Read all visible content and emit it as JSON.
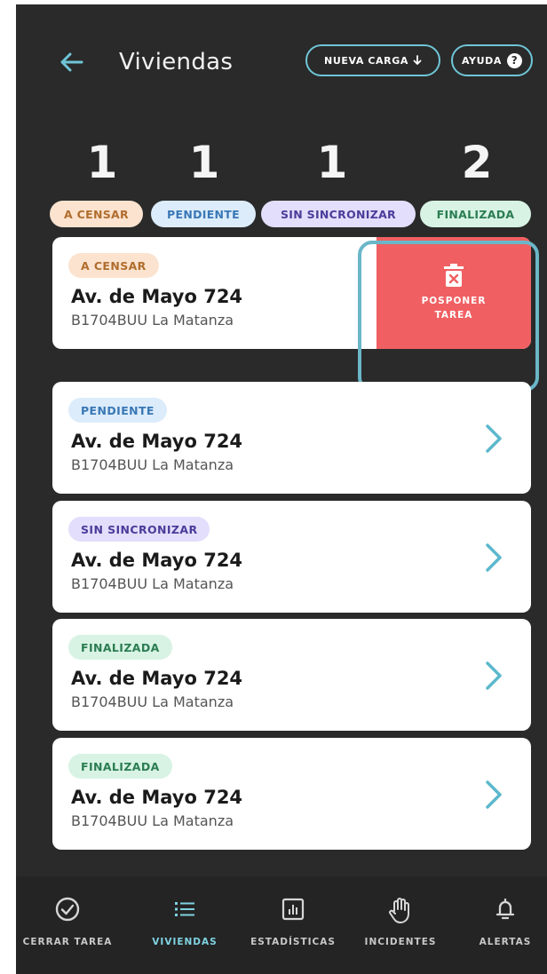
{
  "header": {
    "title": "Viviendas",
    "nueva_carga_label": "NUEVA CARGA",
    "nueva_carga_icon": "download-arrow-icon",
    "ayuda_label": "AYUDA",
    "ayuda_icon": "?"
  },
  "stats": [
    {
      "count": "1",
      "label": "A CENSAR"
    },
    {
      "count": "1",
      "label": "PENDIENTE"
    },
    {
      "count": "1",
      "label": "SIN SINCRONIZAR"
    },
    {
      "count": "2",
      "label": "FINALIZADA"
    }
  ],
  "cards": [
    {
      "status": "A CENSAR",
      "address": "Av. de Mayo 724",
      "locality": "B1704BUU La Matanza"
    },
    {
      "status": "PENDIENTE",
      "address": "Av. de Mayo 724",
      "locality": "B1704BUU La Matanza"
    },
    {
      "status": "SIN SINCRONIZAR",
      "address": "Av. de Mayo 724",
      "locality": "B1704BUU La Matanza"
    },
    {
      "status": "FINALIZADA",
      "address": "Av. de Mayo 724",
      "locality": "B1704BUU La Matanza"
    },
    {
      "status": "FINALIZADA",
      "address": "Av. de Mayo 724",
      "locality": "B1704BUU La Matanza"
    }
  ],
  "swipe_action": {
    "label": "POSPONER TAREA",
    "icon": "trash-icon"
  },
  "nav": [
    {
      "label": "CERRAR TAREA",
      "icon": "check-circle-icon"
    },
    {
      "label": "VIVIENDAS",
      "icon": "list-icon",
      "active": true
    },
    {
      "label": "ESTADÍSTICAS",
      "icon": "bar-chart-icon"
    },
    {
      "label": "INCIDENTES",
      "icon": "hand-icon"
    },
    {
      "label": "ALERTAS",
      "icon": "bell-icon"
    }
  ],
  "colors": {
    "background": "#2a2a2a",
    "accent": "#6fc6d7",
    "delete": "#f06063",
    "a_censar": "#fbe3cf",
    "pendiente": "#dcecfb",
    "sin_sincronizar": "#e3defb",
    "finalizada": "#d8f3e4"
  }
}
